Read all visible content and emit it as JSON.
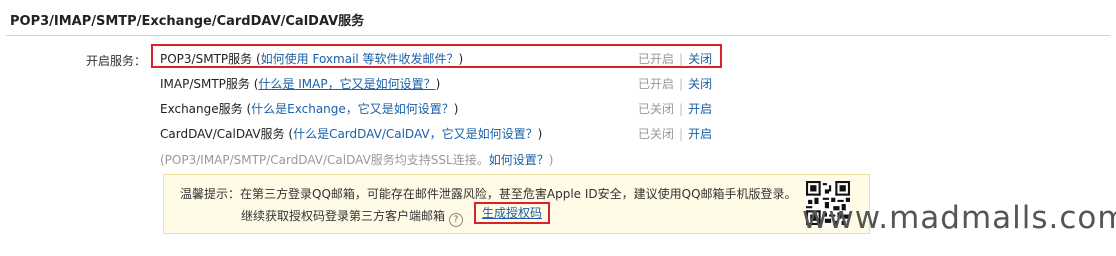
{
  "title": "POP3/IMAP/SMTP/Exchange/CardDAV/CalDAV服务",
  "open_service_label": "开启服务：",
  "services": [
    {
      "name": "POP3/SMTP服务",
      "open": "(",
      "link": "如何使用 Foxmail 等软件收发邮件？",
      "close": ")",
      "state": "已开启",
      "action": "关闭"
    },
    {
      "name": "IMAP/SMTP服务",
      "open": "(",
      "link": "什么是 IMAP，它又是如何设置？",
      "close": ")",
      "state": "已开启",
      "action": "关闭"
    },
    {
      "name": "Exchange服务",
      "open": "(",
      "link": "什么是Exchange，它又是如何设置？",
      "close": ")",
      "state": "已关闭",
      "action": "开启"
    },
    {
      "name": "CardDAV/CalDAV服务",
      "open": "(",
      "link": "什么是CardDAV/CalDAV，它又是如何设置？",
      "close": ")",
      "state": "已关闭",
      "action": "开启"
    }
  ],
  "separator": "|",
  "ssl_note": "(POP3/IMAP/SMTP/CardDAV/CalDAV服务均支持SSL连接。",
  "ssl_link": "如何设置？",
  "ssl_close": ")",
  "tip": {
    "line1": "温馨提示：在第三方登录QQ邮箱，可能存在邮件泄露风险，甚至危害Apple ID安全，建议使用QQ邮箱手机版登录。",
    "line2": "继续获取授权码登录第三方客户端邮箱",
    "help_icon": "?",
    "button": "生成授权码"
  },
  "watermark": "www.madmalls.com",
  "icons": [
    "help-icon",
    "qr-code-icon"
  ]
}
